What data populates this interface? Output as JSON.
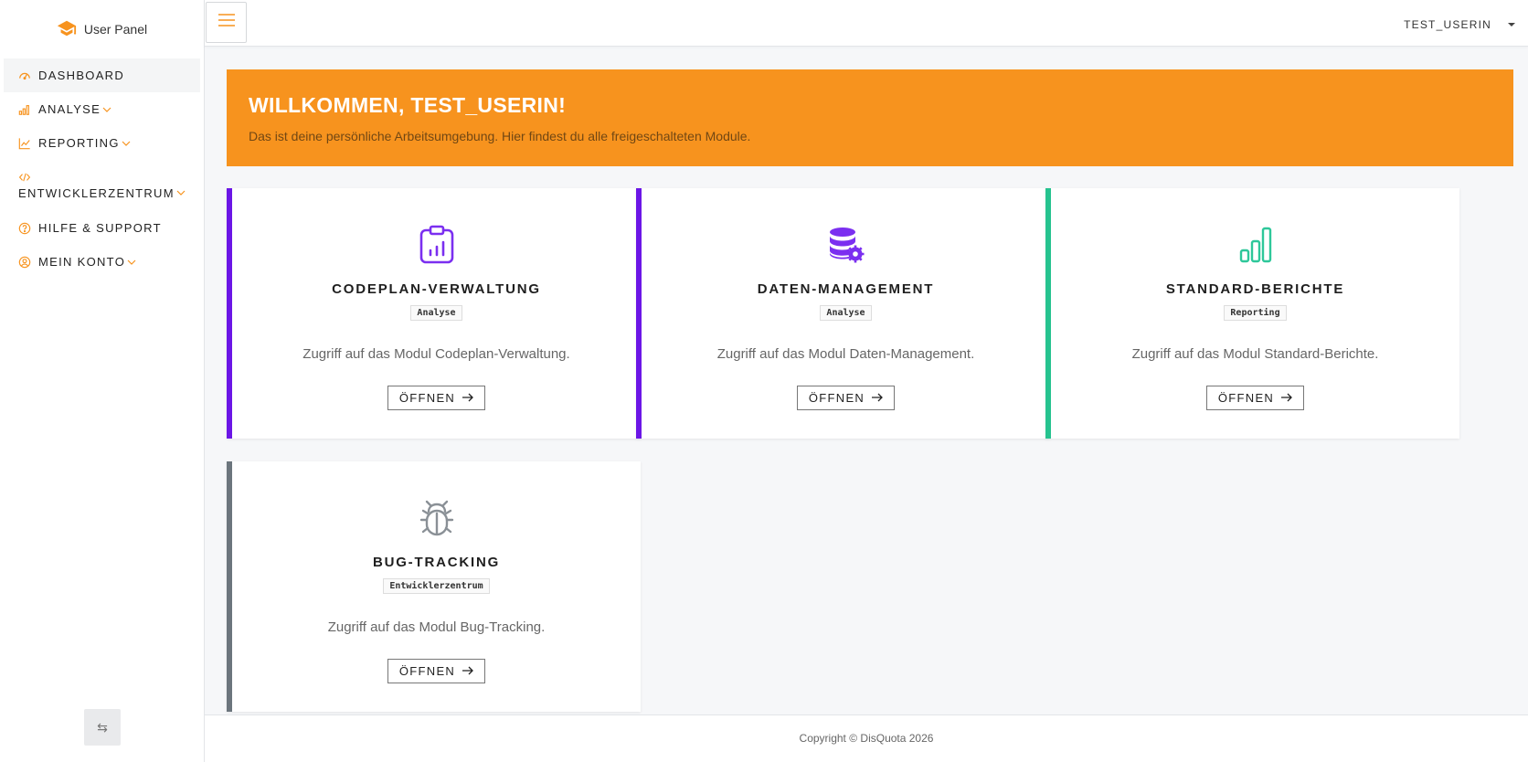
{
  "brand": {
    "title": "User Panel",
    "icon": "graduation-cap-icon",
    "accent": "#f7931e"
  },
  "sidebar": {
    "items": [
      {
        "label": "DASHBOARD",
        "icon": "gauge-icon",
        "active": true
      },
      {
        "label": "ANALYSE",
        "icon": "bar-chart-icon",
        "has_submenu": true
      },
      {
        "label": "REPORTING",
        "icon": "line-chart-icon",
        "has_submenu": true
      },
      {
        "label": "ENTWICKLERZENTRUM",
        "icon": "code-icon",
        "has_submenu": true
      },
      {
        "label": "HILFE & SUPPORT",
        "icon": "question-circle-icon"
      },
      {
        "label": "MEIN KONTO",
        "icon": "user-circle-icon",
        "has_submenu": true
      }
    ],
    "collapse_icon": "arrows-left-right-icon",
    "collapse_glyph": "⇆"
  },
  "topbar": {
    "menu_icon": "hamburger-icon",
    "user": "TEST_USERIN"
  },
  "welcome": {
    "title": "WILLKOMMEN, TEST_USERIN!",
    "subtitle": "Das ist deine persönliche Arbeitsumgebung. Hier findest du alle freigeschalteten Module.",
    "color": "#f7931e"
  },
  "modules": [
    {
      "title": "CODEPLAN-VERWALTUNG",
      "tag": "Analyse",
      "description": "Zugriff auf das Modul Codeplan-Verwaltung.",
      "button": "ÖFFNEN",
      "icon": "clipboard-chart-icon",
      "color": "#6b16e6"
    },
    {
      "title": "DATEN-MANAGEMENT",
      "tag": "Analyse",
      "description": "Zugriff auf das Modul Daten-Management.",
      "button": "ÖFFNEN",
      "icon": "database-gear-icon",
      "color": "#6b16e6"
    },
    {
      "title": "STANDARD-BERICHTE",
      "tag": "Reporting",
      "description": "Zugriff auf das Modul Standard-Berichte.",
      "button": "ÖFFNEN",
      "icon": "bar-chart-icon",
      "color": "#26c38f"
    },
    {
      "title": "BUG-TRACKING",
      "tag": "Entwicklerzentrum",
      "description": "Zugriff auf das Modul Bug-Tracking.",
      "button": "ÖFFNEN",
      "icon": "bug-icon",
      "color": "#6c757d"
    }
  ],
  "footer": {
    "copyright": "Copyright © DisQuota 2026"
  }
}
